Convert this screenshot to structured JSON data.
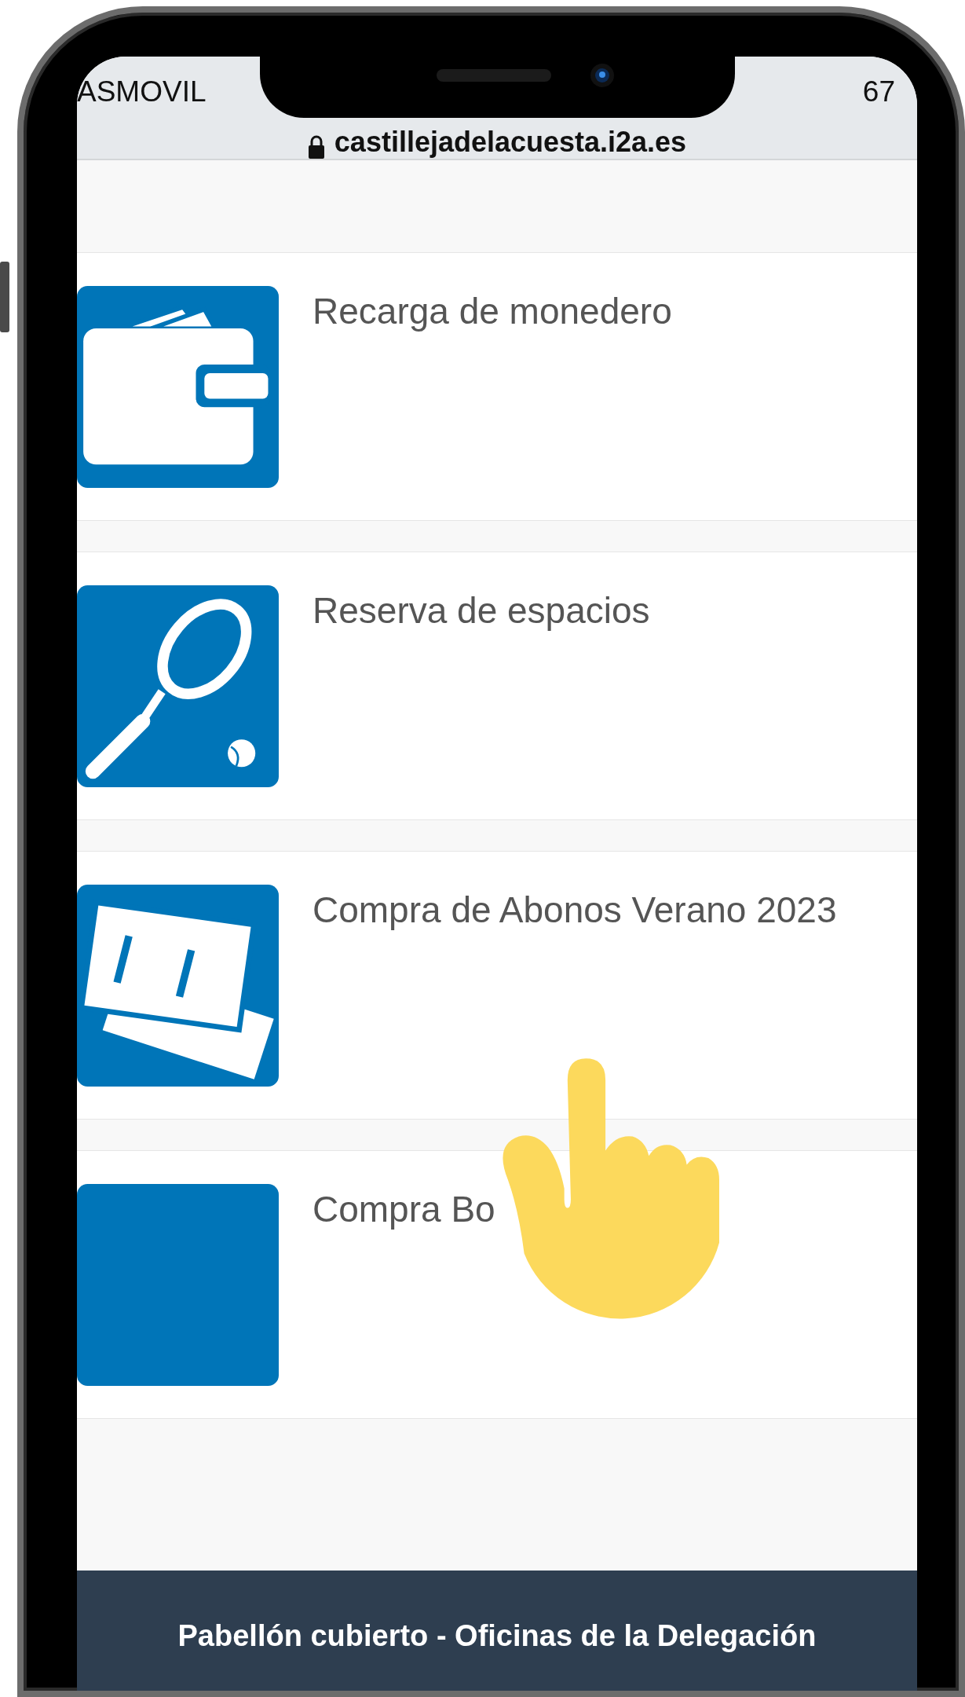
{
  "status_bar": {
    "carrier": "ASMOVIL",
    "battery": "67"
  },
  "address_bar": {
    "url": "castillejadelacuesta.i2a.es"
  },
  "items": [
    {
      "label": "Recarga de monedero",
      "kind": "wallet"
    },
    {
      "label": "Reserva de espacios",
      "kind": "racket"
    },
    {
      "label": "Compra de Abonos Verano 2023",
      "kind": "tickets"
    },
    {
      "label": "Compra Bo",
      "kind": "blank"
    }
  ],
  "footer": {
    "text": "Pabellón cubierto - Oficinas de la Delegación"
  }
}
